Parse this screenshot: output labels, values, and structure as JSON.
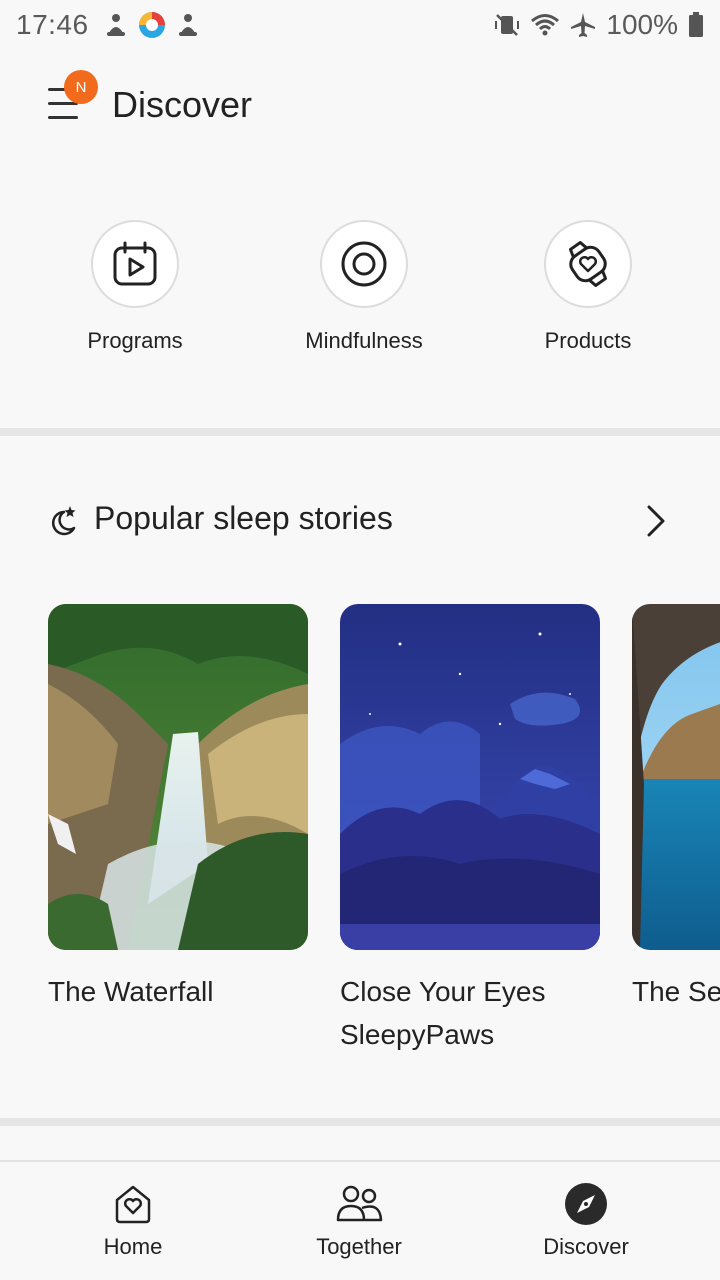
{
  "status": {
    "time": "17:46",
    "battery": "100%"
  },
  "header": {
    "title": "Discover",
    "badge": "N"
  },
  "quick_links": [
    {
      "label": "Programs",
      "icon": "calendar-play-icon"
    },
    {
      "label": "Mindfulness",
      "icon": "target-circle-icon"
    },
    {
      "label": "Products",
      "icon": "watch-heart-icon"
    }
  ],
  "sleep_section": {
    "title": "Popular sleep stories",
    "stories": [
      {
        "title": "The Waterfall"
      },
      {
        "title": "Close Your Eyes SleepyPaws"
      },
      {
        "title": "The Se"
      }
    ]
  },
  "bottom_nav": [
    {
      "label": "Home",
      "icon": "home-heart-icon"
    },
    {
      "label": "Together",
      "icon": "people-icon"
    },
    {
      "label": "Discover",
      "icon": "compass-icon",
      "selected": true
    }
  ]
}
